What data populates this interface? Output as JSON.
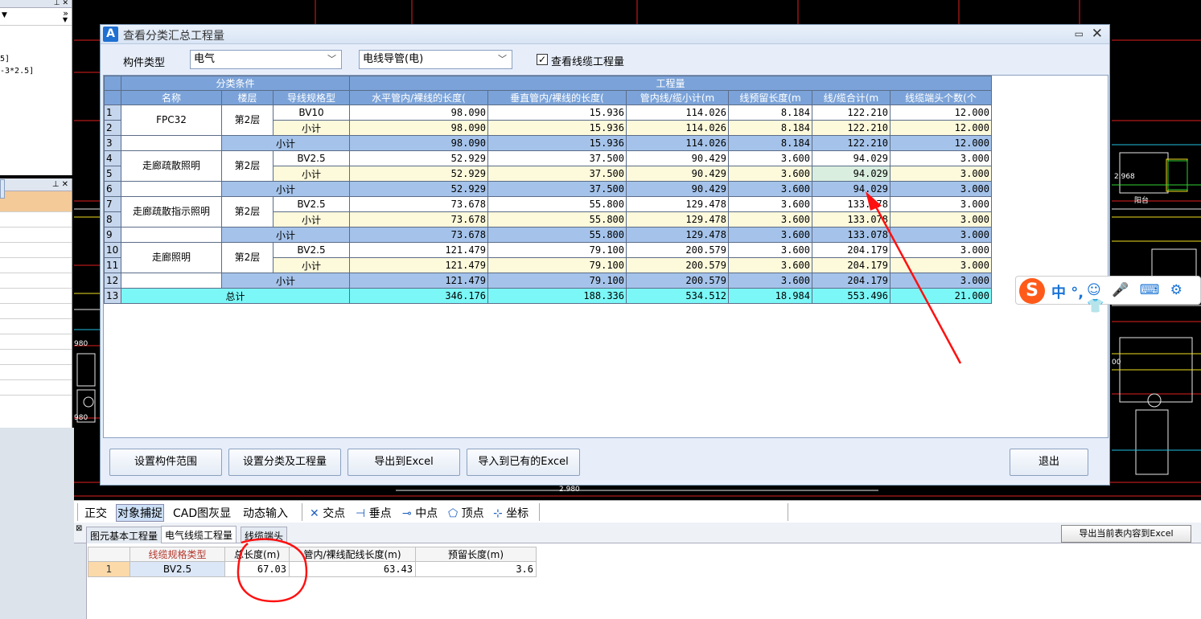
{
  "left_panel": {
    "top_text_lines": [
      "5]",
      "-3*2.5]"
    ]
  },
  "dialog": {
    "title": "查看分类汇总工程量",
    "minimize_icon": "▭",
    "close_icon": "✕",
    "component_type_label": "构件类型",
    "component_type_value": "电气",
    "sub_type_value": "电线导管(电)",
    "show_cable_checked": "✓",
    "show_cable_label": "查看线缆工程量"
  },
  "table": {
    "group_header_left": "分类条件",
    "group_header_right": "工程量",
    "columns": [
      "名称",
      "楼层",
      "导线规格型",
      "水平管内/裸线的长度(",
      "垂直管内/裸线的长度(",
      "管内线/缆小计(m",
      "线预留长度(m",
      "线/缆合计(m",
      "线缆端头个数(个"
    ],
    "rows": [
      {
        "n": "1",
        "floor": "第2层",
        "spec": "BV10",
        "v": [
          "98.090",
          "15.936",
          "114.026",
          "8.184",
          "122.210",
          "12.000"
        ]
      },
      {
        "n": "2",
        "spec": "小计",
        "v": [
          "98.090",
          "15.936",
          "114.026",
          "8.184",
          "122.210",
          "12.000"
        ]
      },
      {
        "n": "3",
        "label": "小计",
        "v": [
          "98.090",
          "15.936",
          "114.026",
          "8.184",
          "122.210",
          "12.000"
        ]
      },
      {
        "n": "4",
        "floor": "第2层",
        "spec": "BV2.5",
        "v": [
          "52.929",
          "37.500",
          "90.429",
          "3.600",
          "94.029",
          "3.000"
        ]
      },
      {
        "n": "5",
        "spec": "小计",
        "v": [
          "52.929",
          "37.500",
          "90.429",
          "3.600",
          "94.029",
          "3.000"
        ]
      },
      {
        "n": "6",
        "label": "小计",
        "v": [
          "52.929",
          "37.500",
          "90.429",
          "3.600",
          "94.029",
          "3.000"
        ]
      },
      {
        "n": "7",
        "floor": "第2层",
        "spec": "BV2.5",
        "v": [
          "73.678",
          "55.800",
          "129.478",
          "3.600",
          "133.078",
          "3.000"
        ]
      },
      {
        "n": "8",
        "spec": "小计",
        "v": [
          "73.678",
          "55.800",
          "129.478",
          "3.600",
          "133.078",
          "3.000"
        ]
      },
      {
        "n": "9",
        "label": "小计",
        "v": [
          "73.678",
          "55.800",
          "129.478",
          "3.600",
          "133.078",
          "3.000"
        ]
      },
      {
        "n": "10",
        "floor": "第2层",
        "spec": "BV2.5",
        "v": [
          "121.479",
          "79.100",
          "200.579",
          "3.600",
          "204.179",
          "3.000"
        ]
      },
      {
        "n": "11",
        "spec": "小计",
        "v": [
          "121.479",
          "79.100",
          "200.579",
          "3.600",
          "204.179",
          "3.000"
        ]
      },
      {
        "n": "12",
        "label": "小计",
        "v": [
          "121.479",
          "79.100",
          "200.579",
          "3.600",
          "204.179",
          "3.000"
        ]
      },
      {
        "n": "13",
        "label": "总计",
        "v": [
          "346.176",
          "188.336",
          "534.512",
          "18.984",
          "553.496",
          "21.000"
        ]
      }
    ],
    "names": [
      "FPC32",
      "走廊疏散照明",
      "走廊疏散指示照明",
      "走廊照明"
    ]
  },
  "buttons": {
    "set_range": "设置构件范围",
    "set_category": "设置分类及工程量",
    "export_excel": "导出到Excel",
    "import_excel": "导入到已有的Excel",
    "exit": "退出"
  },
  "status_bar": {
    "ortho": "正交",
    "snap": "对象捕捉",
    "cad_gray": "CAD图灰显",
    "dynamic_input": "动态输入",
    "intersection": "交点",
    "perpendicular": "垂点",
    "midpoint": "中点",
    "vertex": "顶点",
    "coordinate": "坐标"
  },
  "bottom_panel": {
    "tabs": [
      "图元基本工程量",
      "电气线缆工程量",
      "线缆端头"
    ],
    "export_current": "导出当前表内容到Excel",
    "columns": [
      "线缆规格类型",
      "总长度(m)",
      "管内/裸线配线长度(m)",
      "预留长度(m)"
    ],
    "rows": [
      {
        "n": "1",
        "spec": "BV2.5",
        "total": "67.03",
        "inner": "63.43",
        "reserve": "3.6"
      }
    ]
  },
  "ime": {
    "logo": "S",
    "mode": "中 °,",
    "icons": "☺ 🎤 ⌨ ⚙ 👕"
  },
  "cad_labels": {
    "dim1": "2.980",
    "dim2": "2.968",
    "room": "阳台",
    "num980": "980",
    "num00": "00"
  },
  "colors": {
    "header_blue": "#7ba3d9",
    "total_cyan": "#7bf7f7",
    "subtotal_blue": "#a5c3ea",
    "annotation_red": "#ff1010"
  }
}
